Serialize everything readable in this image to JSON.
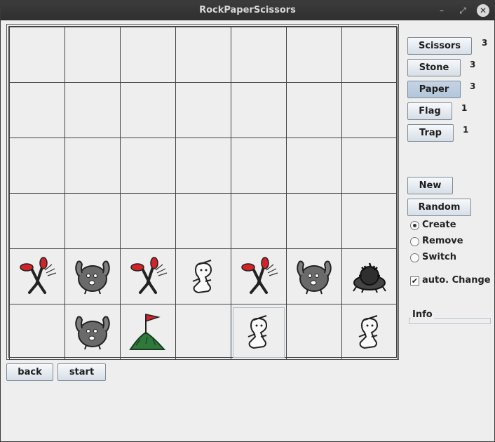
{
  "window": {
    "title": "RockPaperScissors"
  },
  "controls": {
    "minimize_glyph": "–",
    "maximize_glyph": "⤢",
    "close_glyph": "✕"
  },
  "pieces": {
    "buttons": [
      {
        "label": "Scissors",
        "count": "3",
        "pressed": false
      },
      {
        "label": "Stone",
        "count": "3",
        "pressed": false
      },
      {
        "label": "Paper",
        "count": "3",
        "pressed": true
      },
      {
        "label": "Flag",
        "count": "1",
        "pressed": false
      },
      {
        "label": "Trap",
        "count": "1",
        "pressed": false
      }
    ]
  },
  "actions": {
    "new_label": "New",
    "random_label": "Random"
  },
  "mode": {
    "options": [
      {
        "label": "Create",
        "selected": true
      },
      {
        "label": "Remove",
        "selected": false
      },
      {
        "label": "Switch",
        "selected": false
      }
    ]
  },
  "auto_change": {
    "label": "auto. Change",
    "checked": true
  },
  "info": {
    "title": "Info"
  },
  "bottom": {
    "back_label": "back",
    "start_label": "start"
  },
  "board": {
    "rows": 6,
    "cols": 7,
    "cells": [
      [
        "",
        "",
        "",
        "",
        "",
        "",
        ""
      ],
      [
        "",
        "",
        "",
        "",
        "",
        "",
        ""
      ],
      [
        "",
        "",
        "",
        "",
        "",
        "",
        ""
      ],
      [
        "",
        "",
        "",
        "",
        "",
        "",
        ""
      ],
      [
        "scissors-icon",
        "stone-icon",
        "scissors-icon",
        "paper-icon",
        "scissors-icon",
        "stone-icon",
        "trap-icon"
      ],
      [
        "",
        "stone-icon",
        "flag-icon",
        "",
        "paper-icon",
        "",
        "paper-icon"
      ]
    ],
    "selected_cell": [
      5,
      4
    ]
  }
}
